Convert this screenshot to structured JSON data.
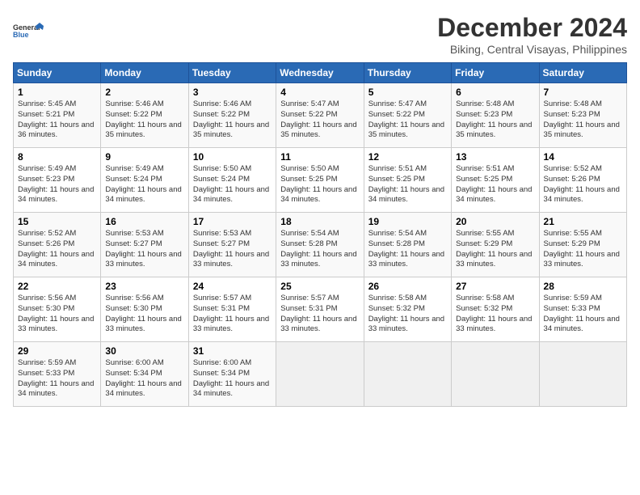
{
  "logo": {
    "line1": "General",
    "line2": "Blue"
  },
  "title": "December 2024",
  "subtitle": "Biking, Central Visayas, Philippines",
  "days_header": [
    "Sunday",
    "Monday",
    "Tuesday",
    "Wednesday",
    "Thursday",
    "Friday",
    "Saturday"
  ],
  "weeks": [
    [
      {
        "day": "1",
        "sunrise": "5:45 AM",
        "sunset": "5:21 PM",
        "daylight": "11 hours and 36 minutes."
      },
      {
        "day": "2",
        "sunrise": "5:46 AM",
        "sunset": "5:22 PM",
        "daylight": "11 hours and 35 minutes."
      },
      {
        "day": "3",
        "sunrise": "5:46 AM",
        "sunset": "5:22 PM",
        "daylight": "11 hours and 35 minutes."
      },
      {
        "day": "4",
        "sunrise": "5:47 AM",
        "sunset": "5:22 PM",
        "daylight": "11 hours and 35 minutes."
      },
      {
        "day": "5",
        "sunrise": "5:47 AM",
        "sunset": "5:22 PM",
        "daylight": "11 hours and 35 minutes."
      },
      {
        "day": "6",
        "sunrise": "5:48 AM",
        "sunset": "5:23 PM",
        "daylight": "11 hours and 35 minutes."
      },
      {
        "day": "7",
        "sunrise": "5:48 AM",
        "sunset": "5:23 PM",
        "daylight": "11 hours and 35 minutes."
      }
    ],
    [
      {
        "day": "8",
        "sunrise": "5:49 AM",
        "sunset": "5:23 PM",
        "daylight": "11 hours and 34 minutes."
      },
      {
        "day": "9",
        "sunrise": "5:49 AM",
        "sunset": "5:24 PM",
        "daylight": "11 hours and 34 minutes."
      },
      {
        "day": "10",
        "sunrise": "5:50 AM",
        "sunset": "5:24 PM",
        "daylight": "11 hours and 34 minutes."
      },
      {
        "day": "11",
        "sunrise": "5:50 AM",
        "sunset": "5:25 PM",
        "daylight": "11 hours and 34 minutes."
      },
      {
        "day": "12",
        "sunrise": "5:51 AM",
        "sunset": "5:25 PM",
        "daylight": "11 hours and 34 minutes."
      },
      {
        "day": "13",
        "sunrise": "5:51 AM",
        "sunset": "5:25 PM",
        "daylight": "11 hours and 34 minutes."
      },
      {
        "day": "14",
        "sunrise": "5:52 AM",
        "sunset": "5:26 PM",
        "daylight": "11 hours and 34 minutes."
      }
    ],
    [
      {
        "day": "15",
        "sunrise": "5:52 AM",
        "sunset": "5:26 PM",
        "daylight": "11 hours and 34 minutes."
      },
      {
        "day": "16",
        "sunrise": "5:53 AM",
        "sunset": "5:27 PM",
        "daylight": "11 hours and 33 minutes."
      },
      {
        "day": "17",
        "sunrise": "5:53 AM",
        "sunset": "5:27 PM",
        "daylight": "11 hours and 33 minutes."
      },
      {
        "day": "18",
        "sunrise": "5:54 AM",
        "sunset": "5:28 PM",
        "daylight": "11 hours and 33 minutes."
      },
      {
        "day": "19",
        "sunrise": "5:54 AM",
        "sunset": "5:28 PM",
        "daylight": "11 hours and 33 minutes."
      },
      {
        "day": "20",
        "sunrise": "5:55 AM",
        "sunset": "5:29 PM",
        "daylight": "11 hours and 33 minutes."
      },
      {
        "day": "21",
        "sunrise": "5:55 AM",
        "sunset": "5:29 PM",
        "daylight": "11 hours and 33 minutes."
      }
    ],
    [
      {
        "day": "22",
        "sunrise": "5:56 AM",
        "sunset": "5:30 PM",
        "daylight": "11 hours and 33 minutes."
      },
      {
        "day": "23",
        "sunrise": "5:56 AM",
        "sunset": "5:30 PM",
        "daylight": "11 hours and 33 minutes."
      },
      {
        "day": "24",
        "sunrise": "5:57 AM",
        "sunset": "5:31 PM",
        "daylight": "11 hours and 33 minutes."
      },
      {
        "day": "25",
        "sunrise": "5:57 AM",
        "sunset": "5:31 PM",
        "daylight": "11 hours and 33 minutes."
      },
      {
        "day": "26",
        "sunrise": "5:58 AM",
        "sunset": "5:32 PM",
        "daylight": "11 hours and 33 minutes."
      },
      {
        "day": "27",
        "sunrise": "5:58 AM",
        "sunset": "5:32 PM",
        "daylight": "11 hours and 33 minutes."
      },
      {
        "day": "28",
        "sunrise": "5:59 AM",
        "sunset": "5:33 PM",
        "daylight": "11 hours and 34 minutes."
      }
    ],
    [
      {
        "day": "29",
        "sunrise": "5:59 AM",
        "sunset": "5:33 PM",
        "daylight": "11 hours and 34 minutes."
      },
      {
        "day": "30",
        "sunrise": "6:00 AM",
        "sunset": "5:34 PM",
        "daylight": "11 hours and 34 minutes."
      },
      {
        "day": "31",
        "sunrise": "6:00 AM",
        "sunset": "5:34 PM",
        "daylight": "11 hours and 34 minutes."
      },
      null,
      null,
      null,
      null
    ]
  ]
}
